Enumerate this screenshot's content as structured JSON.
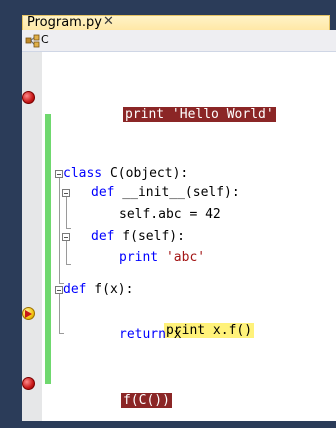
{
  "tab": {
    "title": "Program.py",
    "close_glyph": "✕"
  },
  "navbar": {
    "class_name": "C",
    "icon": "class-icon"
  },
  "code": {
    "line1": "print 'Hello World'",
    "class_kw": "class",
    "class_rest": " C(object):",
    "def1_kw": "def",
    "def1_rest": " __init__(self):",
    "assign": "self.abc = 42",
    "def2_kw": "def",
    "def2_rest": " f(self):",
    "print_kw": "print",
    "print_str": "'abc'",
    "def3_kw": "def",
    "def3_rest": " f(x):",
    "current": "print x.f()",
    "return_kw": "return",
    "return_rest": " x",
    "last": "f(C())"
  },
  "colors": {
    "keyword": "#0000ff",
    "string": "#a31515",
    "breakpoint_highlight": "#8b2626",
    "current_line_highlight": "#fff27a",
    "change_bar": "#6fd86e"
  }
}
